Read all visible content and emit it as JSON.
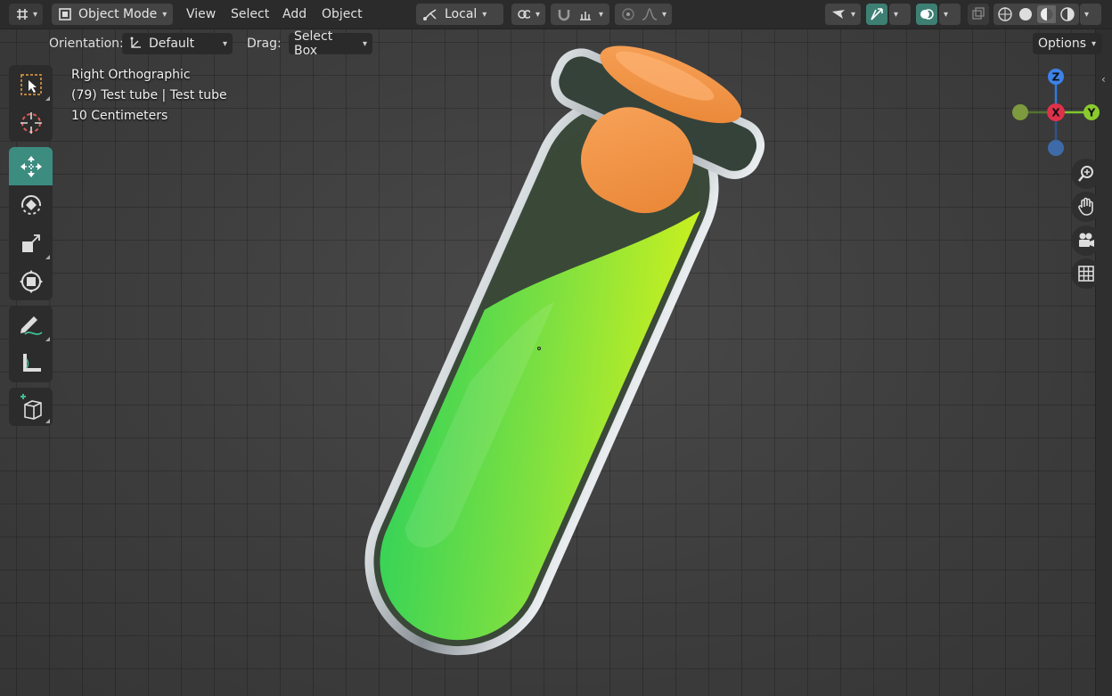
{
  "header": {
    "editor_type_icon": "axes-grid-icon",
    "mode": "Object Mode",
    "menus": [
      "View",
      "Select",
      "Add",
      "Object"
    ],
    "transform_pivot": "Local",
    "colors": {
      "header_bg": "#2b2b2b",
      "accent": "#3c8c80",
      "axis_x": "#e0314a",
      "axis_y": "#7ec72e",
      "axis_z": "#2e7ae0"
    }
  },
  "tool_settings": {
    "orientation_label": "Orientation:",
    "orientation_value": "Default",
    "drag_label": "Drag:",
    "drag_value": "Select Box",
    "options_label": "Options"
  },
  "viewport": {
    "view_name": "Right Orthographic",
    "object_info": "(79) Test tube | Test tube",
    "scale_info": "10 Centimeters"
  },
  "gizmo": {
    "z": "Z",
    "x": "X",
    "y": "Y"
  }
}
